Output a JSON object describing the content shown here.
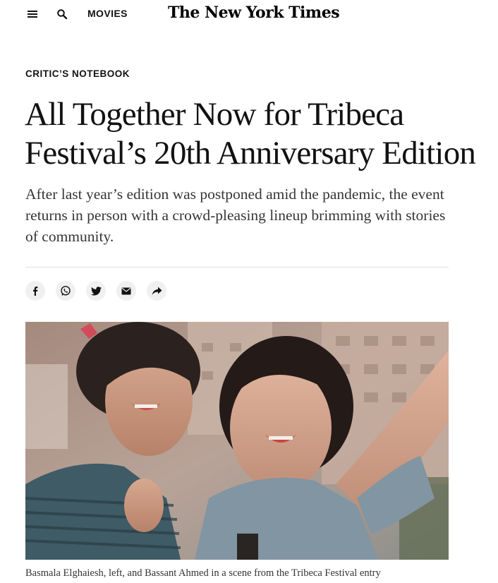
{
  "header": {
    "menu_icon": "hamburger-menu-icon",
    "search_icon": "search-icon",
    "section_label": "MOVIES",
    "logo_text": "The New York Times"
  },
  "article": {
    "kicker": "CRITIC’S NOTEBOOK",
    "headline": "All Together Now for Tribeca Festival’s 20th Anniversary Edition",
    "summary": "After last year’s edition was postponed amid the pandemic, the event returns in person with a crowd-pleasing lineup brimming with stories of community.",
    "share_buttons": [
      {
        "icon": "facebook-icon"
      },
      {
        "icon": "whatsapp-icon"
      },
      {
        "icon": "twitter-icon"
      },
      {
        "icon": "email-icon"
      },
      {
        "icon": "share-arrow-icon"
      }
    ],
    "hero_image": {
      "alt": "Basmala Elghaiesh and Bassant Ahmed taking a selfie"
    },
    "caption": "Basmala Elghaiesh, left, and Bassant Ahmed in a scene from the Tribeca Festival entry"
  },
  "colors": {
    "text": "#121212",
    "summary_text": "#363636",
    "share_bg": "#f0f0f0",
    "divider": "#dfdfdf"
  }
}
